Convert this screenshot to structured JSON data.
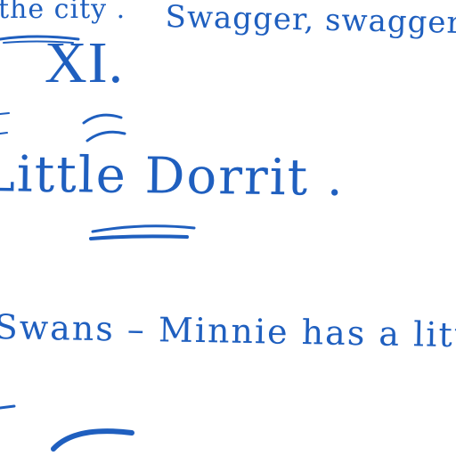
{
  "lines": {
    "line1": "the city .",
    "line2": "Swagger, swagger",
    "line3": "XI.",
    "line4": "Little Dorrit .",
    "line5": "Swans – Minnie has a little"
  },
  "colors": {
    "ink": "#1f5fbf"
  }
}
